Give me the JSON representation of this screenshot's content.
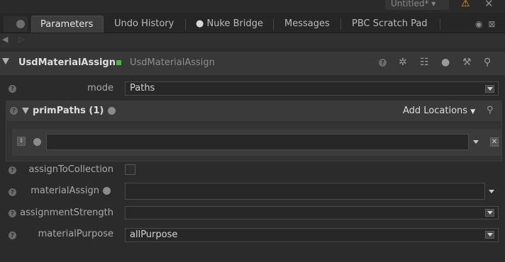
{
  "window": {
    "project_label": "Untitled*"
  },
  "tabs": [
    {
      "label": "Parameters",
      "active": true
    },
    {
      "label": "Undo History",
      "active": false
    },
    {
      "label": "Nuke Bridge",
      "active": false,
      "icon": "globe-icon"
    },
    {
      "label": "Messages",
      "active": false
    },
    {
      "label": "PBC Scratch Pad",
      "active": false
    }
  ],
  "node": {
    "name": "UsdMaterialAssign",
    "type": "UsdMaterialAssign",
    "status_color": "#4bb543"
  },
  "params": {
    "mode": {
      "label": "mode",
      "value": "Paths"
    },
    "primPaths": {
      "label": "primPaths (1)",
      "add_locations": "Add Locations",
      "entry_value": ""
    },
    "assignToCollection": {
      "label": "assignToCollection",
      "checked": false
    },
    "materialAssign": {
      "label": "materialAssign",
      "value": ""
    },
    "assignmentStrength": {
      "label": "assignmentStrength",
      "value": ""
    },
    "materialPurpose": {
      "label": "materialPurpose",
      "value": "allPurpose"
    }
  },
  "colors": {
    "accent_green": "#4bb543",
    "warning": "#e8a020",
    "background": "#2b2b2b"
  }
}
